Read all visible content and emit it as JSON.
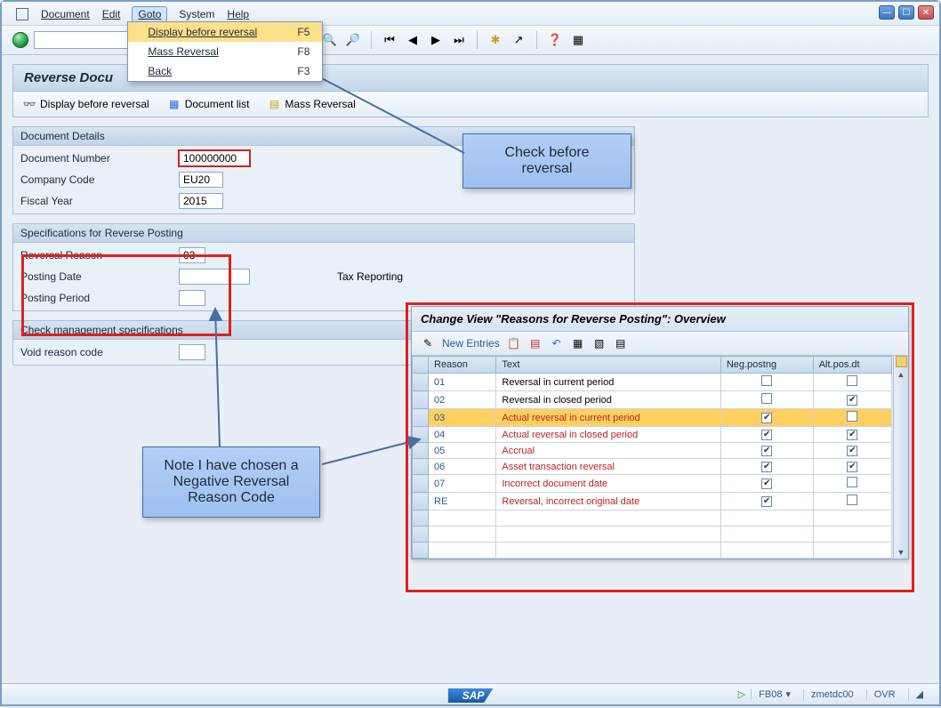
{
  "menu": {
    "items": [
      "Document",
      "Edit",
      "Goto",
      "System",
      "Help"
    ],
    "open_index": 2,
    "dropdown": [
      {
        "label": "Display before reversal",
        "shortcut": "F5",
        "highlight": true
      },
      {
        "label": "Mass Reversal",
        "shortcut": "F8",
        "highlight": false
      },
      {
        "label": "Back",
        "shortcut": "F3",
        "highlight": false
      }
    ]
  },
  "page_title": "Reverse Docu",
  "subtoolbar": {
    "display_before": "Display before reversal",
    "doc_list": "Document list",
    "mass_reversal": "Mass Reversal"
  },
  "groups": {
    "doc_details": {
      "title": "Document Details",
      "doc_number_label": "Document Number",
      "doc_number": "100000000",
      "company_code_label": "Company Code",
      "company_code": "EU20",
      "fiscal_year_label": "Fiscal Year",
      "fiscal_year": "2015"
    },
    "reverse_spec": {
      "title": "Specifications for Reverse Posting",
      "reason_label": "Reversal Reason",
      "reason": "03",
      "posting_date_label": "Posting Date",
      "posting_date": "",
      "tax_reporting_label": "Tax Reporting",
      "posting_period_label": "Posting Period",
      "posting_period": ""
    },
    "check_mgmt": {
      "title": "Check management specifications",
      "void_label": "Void reason code",
      "void": ""
    }
  },
  "callouts": {
    "check_before": "Check before reversal",
    "note_negative": "Note I have chosen a Negative Reversal Reason Code"
  },
  "overview": {
    "title": "Change View \"Reasons for Reverse Posting\": Overview",
    "new_entries": "New Entries",
    "columns": [
      "Reason",
      "Text",
      "Neg.postng",
      "Alt.pos.dt"
    ],
    "rows": [
      {
        "reason": "01",
        "text": "Reversal in current period",
        "neg": false,
        "alt": false,
        "red": false,
        "sel": false
      },
      {
        "reason": "02",
        "text": "Reversal in closed period",
        "neg": false,
        "alt": true,
        "red": false,
        "sel": false
      },
      {
        "reason": "03",
        "text": "Actual reversal in current period",
        "neg": true,
        "alt": false,
        "red": true,
        "sel": true
      },
      {
        "reason": "04",
        "text": "Actual reversal in closed period",
        "neg": true,
        "alt": true,
        "red": true,
        "sel": false
      },
      {
        "reason": "05",
        "text": "Accrual",
        "neg": true,
        "alt": true,
        "red": true,
        "sel": false
      },
      {
        "reason": "06",
        "text": "Asset transaction reversal",
        "neg": true,
        "alt": true,
        "red": true,
        "sel": false
      },
      {
        "reason": "07",
        "text": "Incorrect document date",
        "neg": true,
        "alt": false,
        "red": true,
        "sel": false
      },
      {
        "reason": "RE",
        "text": "Reversal, incorrect original date",
        "neg": true,
        "alt": false,
        "red": true,
        "sel": false
      }
    ]
  },
  "statusbar": {
    "tcode": "FB08",
    "system": "zmetdc00",
    "mode": "OVR"
  },
  "sap_logo": "SAP"
}
